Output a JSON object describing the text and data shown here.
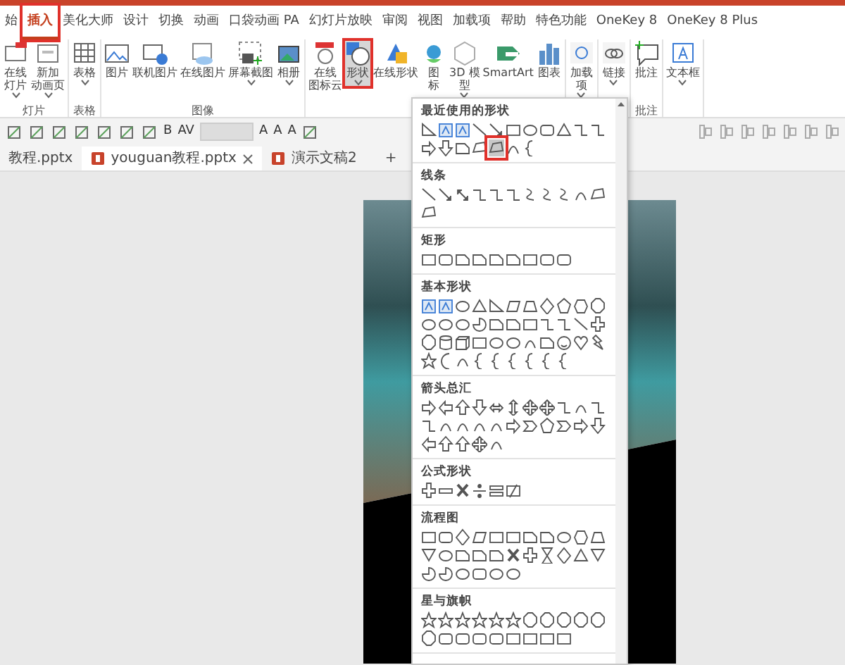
{
  "tabs": [
    {
      "label": "始",
      "selected": false,
      "highlighted": false
    },
    {
      "label": "插入",
      "selected": true,
      "highlighted": true
    },
    {
      "label": "美化大师",
      "selected": false,
      "highlighted": false
    },
    {
      "label": "设计",
      "selected": false,
      "highlighted": false
    },
    {
      "label": "切换",
      "selected": false,
      "highlighted": false
    },
    {
      "label": "动画",
      "selected": false,
      "highlighted": false
    },
    {
      "label": "口袋动画 PA",
      "selected": false,
      "highlighted": false
    },
    {
      "label": "幻灯片放映",
      "selected": false,
      "highlighted": false
    },
    {
      "label": "审阅",
      "selected": false,
      "highlighted": false
    },
    {
      "label": "视图",
      "selected": false,
      "highlighted": false
    },
    {
      "label": "加载项",
      "selected": false,
      "highlighted": false
    },
    {
      "label": "帮助",
      "selected": false,
      "highlighted": false
    },
    {
      "label": "特色功能",
      "selected": false,
      "highlighted": false
    },
    {
      "label": "OneKey 8",
      "selected": false,
      "highlighted": false
    },
    {
      "label": "OneKey 8 Plus",
      "selected": false,
      "highlighted": false
    }
  ],
  "ribbon_groups": [
    {
      "label": "灯片",
      "buttons": [
        {
          "lines": [
            "在线",
            "灯片"
          ],
          "dropdown": true,
          "selected": false,
          "highlighted": false
        },
        {
          "lines": [
            "新加",
            "动画页"
          ],
          "dropdown": true,
          "selected": false,
          "highlighted": false
        }
      ]
    },
    {
      "label": "表格",
      "buttons": [
        {
          "lines": [
            "表格"
          ],
          "dropdown": true,
          "selected": false,
          "highlighted": false
        }
      ]
    },
    {
      "label": "图像",
      "buttons": [
        {
          "lines": [
            "图片"
          ],
          "dropdown": false,
          "selected": false,
          "highlighted": false
        },
        {
          "lines": [
            "联机图片"
          ],
          "dropdown": false,
          "selected": false,
          "highlighted": false
        },
        {
          "lines": [
            "在线图片"
          ],
          "dropdown": false,
          "selected": false,
          "highlighted": false
        },
        {
          "lines": [
            "屏幕截图"
          ],
          "dropdown": true,
          "selected": false,
          "highlighted": false
        },
        {
          "lines": [
            "相册"
          ],
          "dropdown": true,
          "selected": false,
          "highlighted": false
        }
      ]
    },
    {
      "buttons": [
        {
          "lines": [
            "在线",
            "图标云"
          ],
          "dropdown": false,
          "selected": false,
          "highlighted": false
        },
        {
          "lines": [
            "形状"
          ],
          "dropdown": true,
          "selected": true,
          "highlighted": true
        },
        {
          "lines": [
            "在线形状"
          ],
          "dropdown": false,
          "selected": false,
          "highlighted": false
        },
        {
          "lines": [
            "图",
            "标"
          ],
          "dropdown": false,
          "selected": false,
          "highlighted": false
        },
        {
          "lines": [
            "3D 模",
            "型"
          ],
          "dropdown": true,
          "selected": false,
          "highlighted": false
        },
        {
          "lines": [
            "SmartArt"
          ],
          "dropdown": false,
          "selected": false,
          "highlighted": false
        },
        {
          "lines": [
            "图表"
          ],
          "dropdown": false,
          "selected": false,
          "highlighted": false
        }
      ]
    },
    {
      "buttons": [
        {
          "lines": [
            "加载",
            "项"
          ],
          "dropdown": true,
          "selected": false,
          "highlighted": false
        }
      ]
    },
    {
      "buttons": [
        {
          "lines": [
            "链接"
          ],
          "dropdown": true,
          "selected": false,
          "highlighted": false
        }
      ]
    },
    {
      "label": "批注",
      "buttons": [
        {
          "lines": [
            "批注"
          ],
          "dropdown": false,
          "selected": false,
          "highlighted": false
        }
      ]
    },
    {
      "buttons": [
        {
          "lines": [
            "文本框"
          ],
          "dropdown": true,
          "selected": false,
          "highlighted": false
        }
      ]
    }
  ],
  "quick_toolbar": [
    {
      "kind": "icon"
    },
    {
      "kind": "icon"
    },
    {
      "kind": "icon"
    },
    {
      "kind": "icon"
    },
    {
      "kind": "icon"
    },
    {
      "kind": "icon"
    },
    {
      "kind": "icon"
    },
    {
      "kind": "text",
      "text": "B"
    },
    {
      "kind": "text",
      "text": "AV"
    },
    {
      "kind": "field"
    },
    {
      "kind": "text",
      "text": "A"
    },
    {
      "kind": "text",
      "text": "A"
    },
    {
      "kind": "text",
      "text": "A"
    },
    {
      "kind": "icon"
    }
  ],
  "file_tabs": [
    {
      "label": "教程.pptx",
      "selected": false,
      "closable": false
    },
    {
      "label": "youguan教程.pptx",
      "selected": true,
      "closable": true
    },
    {
      "label": "演示文稿2",
      "selected": false,
      "closable": false
    }
  ],
  "new_tab": "+",
  "shapes_menu": {
    "sections": [
      {
        "title": "最近使用的形状"
      },
      {
        "title": "线条"
      },
      {
        "title": "矩形"
      },
      {
        "title": "基本形状"
      },
      {
        "title": "箭头总汇"
      },
      {
        "title": "公式形状"
      },
      {
        "title": "流程图"
      },
      {
        "title": "星与旗帜"
      }
    ],
    "recent_shapes": [
      {
        "selected": false,
        "highlighted": false
      },
      {
        "selected": false,
        "highlighted": false
      },
      {
        "selected": false,
        "highlighted": false
      },
      {
        "selected": false,
        "highlighted": false
      },
      {
        "selected": false,
        "highlighted": false
      },
      {
        "selected": false,
        "highlighted": false
      },
      {
        "selected": false,
        "highlighted": false
      },
      {
        "selected": false,
        "highlighted": false
      },
      {
        "selected": false,
        "highlighted": false
      },
      {
        "selected": false,
        "highlighted": false
      },
      {
        "selected": false,
        "highlighted": false
      },
      {
        "selected": false,
        "highlighted": false
      },
      {
        "selected": false,
        "highlighted": false
      },
      {
        "selected": false,
        "highlighted": false
      },
      {
        "selected": false,
        "highlighted": false
      },
      {
        "selected": true,
        "highlighted": true
      },
      {
        "selected": false,
        "highlighted": false
      },
      {
        "selected": false,
        "highlighted": false
      }
    ]
  }
}
